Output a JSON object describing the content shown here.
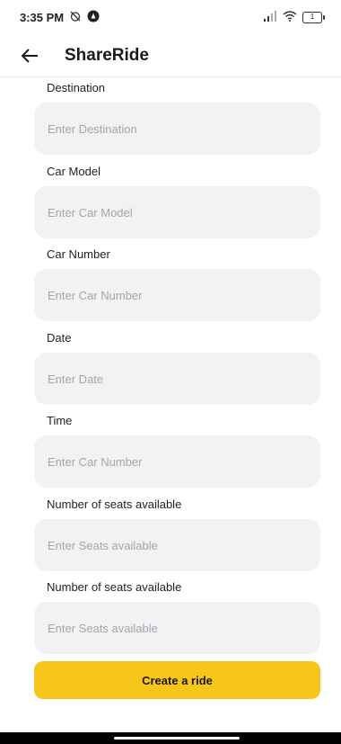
{
  "status_bar": {
    "time": "3:35 PM",
    "battery": "1"
  },
  "app_bar": {
    "title": "ShareRide"
  },
  "form": {
    "fields": [
      {
        "label": "Destination",
        "placeholder": "Enter Destination"
      },
      {
        "label": "Car Model",
        "placeholder": "Enter Car Model"
      },
      {
        "label": "Car Number",
        "placeholder": "Enter Car Number"
      },
      {
        "label": "Date",
        "placeholder": "Enter Date"
      },
      {
        "label": "Time",
        "placeholder": "Enter Car Number"
      },
      {
        "label": "Number of seats available",
        "placeholder": "Enter Seats available"
      },
      {
        "label": "Number of seats available",
        "placeholder": "Enter Seats available"
      }
    ]
  },
  "actions": {
    "create_label": "Create a ride"
  },
  "colors": {
    "accent": "#f8c51a",
    "field_bg": "#f2f2f4"
  }
}
